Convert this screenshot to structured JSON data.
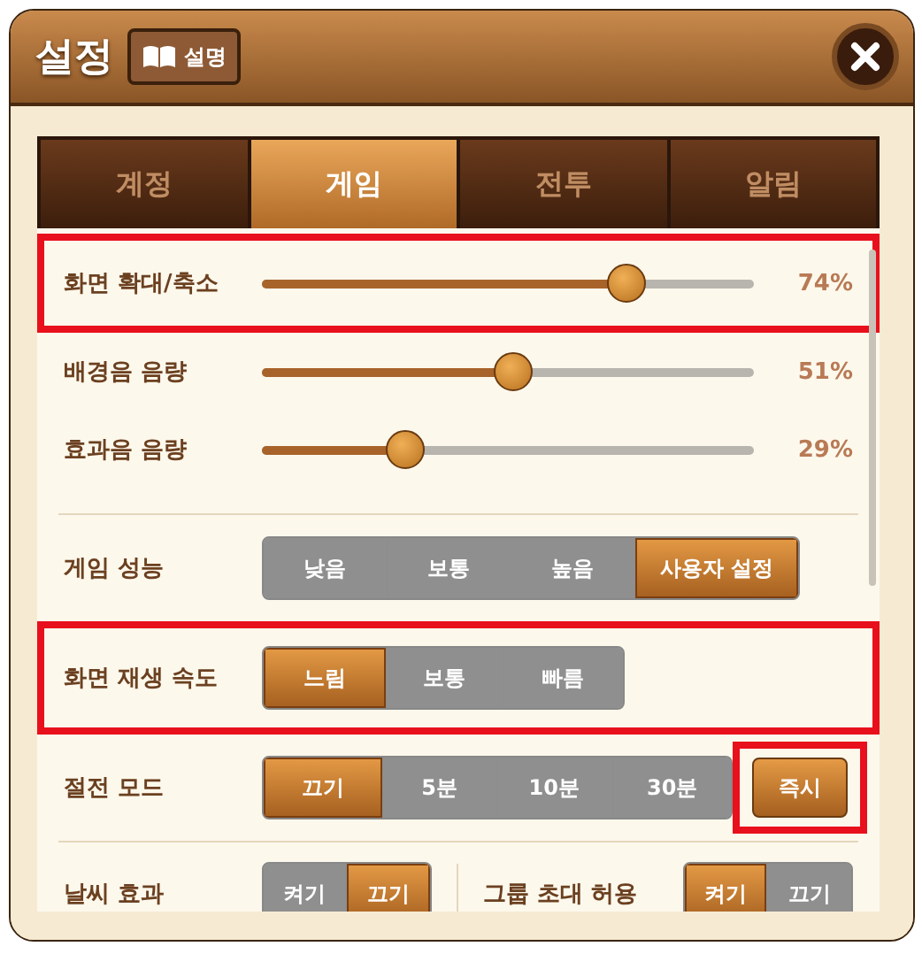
{
  "window": {
    "title": "설정",
    "help_button": "설명"
  },
  "tabs": [
    {
      "label": "계정",
      "selected": false
    },
    {
      "label": "게임",
      "selected": true
    },
    {
      "label": "전투",
      "selected": false
    },
    {
      "label": "알림",
      "selected": false
    }
  ],
  "sliders": [
    {
      "label": "화면 확대/축소",
      "level": 0.74,
      "reading": "74%",
      "highlighted": true
    },
    {
      "label": "배경음 음량",
      "level": 0.51,
      "reading": "51%",
      "highlighted": false
    },
    {
      "label": "효과음 음량",
      "level": 0.29,
      "reading": "29%",
      "highlighted": false
    }
  ],
  "option_rows": [
    {
      "label": "게임 성능",
      "highlighted": false,
      "options": [
        {
          "label": "낮음",
          "selected": false
        },
        {
          "label": "보통",
          "selected": false
        },
        {
          "label": "높음",
          "selected": false
        },
        {
          "label": "사용자 설정",
          "selected": true
        }
      ]
    },
    {
      "label": "화면 재생 속도",
      "highlighted": true,
      "options": [
        {
          "label": "느림",
          "selected": true
        },
        {
          "label": "보통",
          "selected": false
        },
        {
          "label": "빠름",
          "selected": false
        }
      ]
    },
    {
      "label": "절전 모드",
      "highlighted": false,
      "options": [
        {
          "label": "끄기",
          "selected": true
        },
        {
          "label": "5분",
          "selected": false
        },
        {
          "label": "10분",
          "selected": false
        },
        {
          "label": "30분",
          "selected": false
        }
      ],
      "action": {
        "label": "즉시",
        "highlighted": true
      }
    }
  ],
  "toggles": [
    {
      "label": "날씨 효과",
      "options": [
        {
          "label": "켜기",
          "selected": false
        },
        {
          "label": "끄기",
          "selected": true
        }
      ]
    },
    {
      "label": "그룹 초대 허용",
      "options": [
        {
          "label": "켜기",
          "selected": true
        },
        {
          "label": "끄기",
          "selected": false
        }
      ]
    }
  ]
}
